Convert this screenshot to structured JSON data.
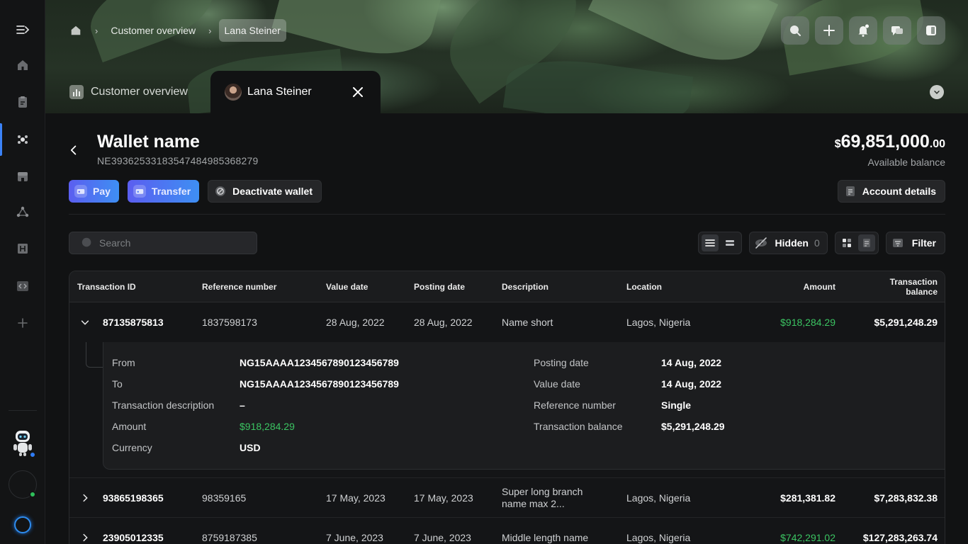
{
  "breadcrumb": {
    "items": [
      "Customer overview"
    ],
    "current": "Lana Steiner"
  },
  "top_actions": [
    "search-icon",
    "plus-icon",
    "bell-icon",
    "chat-icon",
    "sidebar-toggle-icon"
  ],
  "tabs": [
    {
      "label": "Customer overview",
      "icon": "chart-icon"
    },
    {
      "label": "Lana Steiner",
      "icon": "avatar"
    }
  ],
  "wallet": {
    "name": "Wallet name",
    "iban": "NE393625331835474849853682​79",
    "balance_currency": "$",
    "balance_main": "69,851,000",
    "balance_cents": ".00",
    "balance_label": "Available balance"
  },
  "buttons": {
    "pay": "Pay",
    "transfer": "Transfer",
    "deactivate": "Deactivate wallet",
    "account_details": "Account details"
  },
  "search": {
    "placeholder": "Search"
  },
  "tools": {
    "hidden_label": "Hidden",
    "hidden_count": "0",
    "filter_label": "Filter"
  },
  "table": {
    "headers": {
      "transaction_id": "Transaction ID",
      "reference": "Reference number",
      "value_date": "Value date",
      "posting_date": "Posting date",
      "description": "Description",
      "location": "Location",
      "amount": "Amount",
      "balance_line1": "Transaction",
      "balance_line2": "balance"
    },
    "rows": [
      {
        "id": "87135875813",
        "ref": "1837598173",
        "value_date": "28 Aug, 2022",
        "posting_date": "28 Aug, 2022",
        "description": "Name short",
        "location": "Lagos, Nigeria",
        "amount": "$918,284.29",
        "balance": "$5,291,248.29"
      },
      {
        "id": "93865198365",
        "ref": "98359165",
        "value_date": "17 May, 2023",
        "posting_date": "17 May, 2023",
        "description": "Super long branch name  max 2...",
        "location": "Lagos, Nigeria",
        "amount": "$281,381.82",
        "balance": "$7,283,832.38"
      },
      {
        "id": "23905012335",
        "ref": "8759187385",
        "value_date": "7 June, 2023",
        "posting_date": "7 June, 2023",
        "description": "Middle length name",
        "location": "Lagos, Nigeria",
        "amount": "$742,291.02",
        "balance": "$127,283,263.74"
      }
    ]
  },
  "detail": {
    "from_label": "From",
    "from_value": "NG15AAAA1234567890123456789",
    "to_label": "To",
    "to_value": "NG15AAAA1234567890123456789",
    "desc_label": "Transaction description",
    "desc_value": "–",
    "amount_label": "Amount",
    "amount_value": "$918,284.29",
    "currency_label": "Currency",
    "currency_value": "USD",
    "posting_label": "Posting date",
    "posting_value": "14 Aug, 2022",
    "value_label": "Value date",
    "value_value": "14 Aug, 2022",
    "ref_label": "Reference number",
    "ref_value": "Single",
    "balance_label": "Transaction balance",
    "balance_value": "$5,291,248.29"
  },
  "colors": {
    "accent": "#3b82f6",
    "positive": "#3bc462",
    "pay_gradient": [
      "#5b5ef0",
      "#3e8ff3"
    ]
  }
}
